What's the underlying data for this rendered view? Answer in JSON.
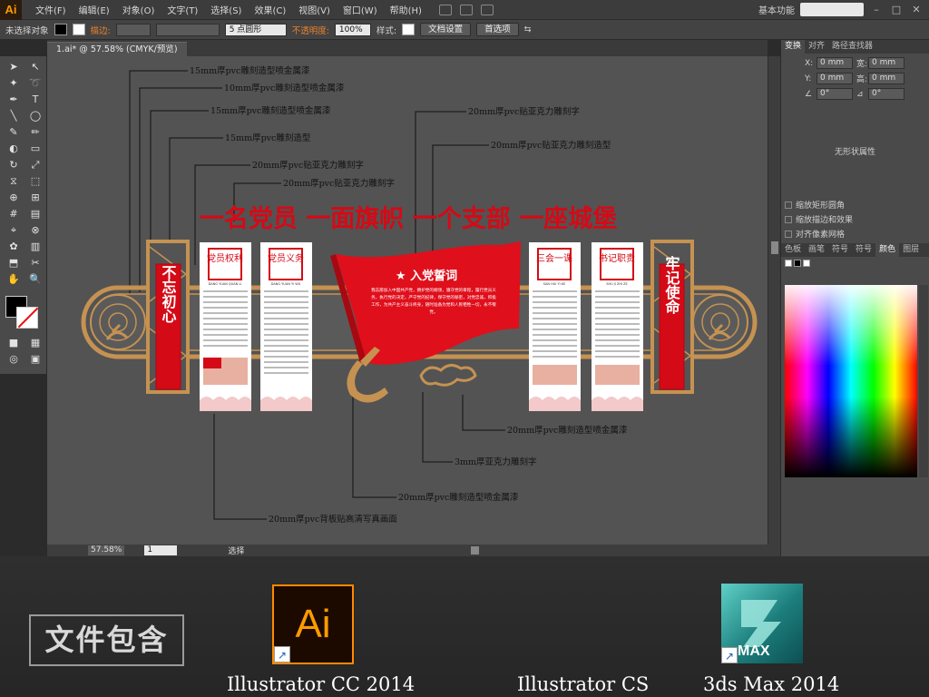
{
  "app": {
    "logo": "Ai",
    "workspace_label": "基本功能"
  },
  "menu": [
    "文件(F)",
    "编辑(E)",
    "对象(O)",
    "文字(T)",
    "选择(S)",
    "效果(C)",
    "视图(V)",
    "窗口(W)",
    "帮助(H)"
  ],
  "control": {
    "no_selection": "未选择对象",
    "stroke_label": "描边:",
    "brush_value": "5 点圆形",
    "opacity_label": "不透明度:",
    "opacity_value": "100%",
    "style_label": "样式:",
    "doc_setup": "文档设置",
    "prefs": "首选项"
  },
  "document": {
    "tab": "1.ai* @ 57.58% (CMYK/预览)"
  },
  "statusbar": {
    "zoom": "57.58%",
    "page": "1",
    "mode": "选择"
  },
  "panel": {
    "tabs1": [
      "变换",
      "对齐",
      "路径查找器"
    ],
    "active_tab1": "变换",
    "fields": [
      {
        "a": "X:",
        "av": "0 mm",
        "b": "宽:",
        "bv": "0 mm"
      },
      {
        "a": "Y:",
        "av": "0 mm",
        "b": "高:",
        "bv": "0 mm"
      }
    ],
    "rot": "0°",
    "shear": "0°",
    "no_shape": "无形状属性",
    "checks": [
      "缩放矩形圆角",
      "缩放描边和效果",
      "对齐像素网格"
    ],
    "tabs2": [
      "色板",
      "画笔",
      "符号",
      "符号",
      "颜色",
      "图层"
    ],
    "active_tab2": "颜色"
  },
  "design": {
    "slogan": "一名党员  一面旗帜  一个支部  一座城堡",
    "left_pillar": "不忘初心",
    "right_pillar": "牢记使命",
    "panels": [
      {
        "title": "党员权利",
        "sub": "DANG YUAN QUAN LI"
      },
      {
        "title": "党员义务",
        "sub": "DANG YUAN YI WU"
      },
      {
        "title": "三会一课",
        "sub": "SAN HUI YI KE"
      },
      {
        "title": "书记职责",
        "sub": "SHU JI ZHI ZE"
      }
    ],
    "flag_title": "★ 入党誓词",
    "oath": "我志愿加入中国共产党，拥护党的纲领，遵守党的章程，履行党员义务，执行党的决定，严守党的纪律，保守党的秘密，对党忠诚，积极工作，为共产主义奋斗终身，随时准备为党和人民牺牲一切，永不叛党。",
    "annotations": [
      "15mm厚pvc雕刻造型喷金属漆",
      "10mm厚pvc雕刻造型喷金属漆",
      "15mm厚pvc雕刻造型喷金属漆",
      "15mm厚pvc雕刻造型",
      "20mm厚pvc贴亚克力雕刻字",
      "20mm厚pvc贴亚克力雕刻字",
      "20mm厚pvc贴亚克力雕刻字",
      "20mm厚pvc贴亚克力雕刻造型",
      "20mm厚pvc雕刻造型喷金属漆",
      "3mm厚亚克力雕刻字",
      "20mm厚pvc雕刻造型喷金属漆",
      "20mm厚pvc背板贴高清写真画面"
    ]
  },
  "banner": {
    "contains": "文件包含",
    "ai_icon": "Ai",
    "max_icon": "MAX",
    "captions": [
      "Illustrator CC 2014",
      "Illustrator CS",
      "3ds Max 2014"
    ]
  },
  "colors": {
    "accent": "#e9812c",
    "party_red": "#d40a16",
    "gold": "#c59252"
  }
}
